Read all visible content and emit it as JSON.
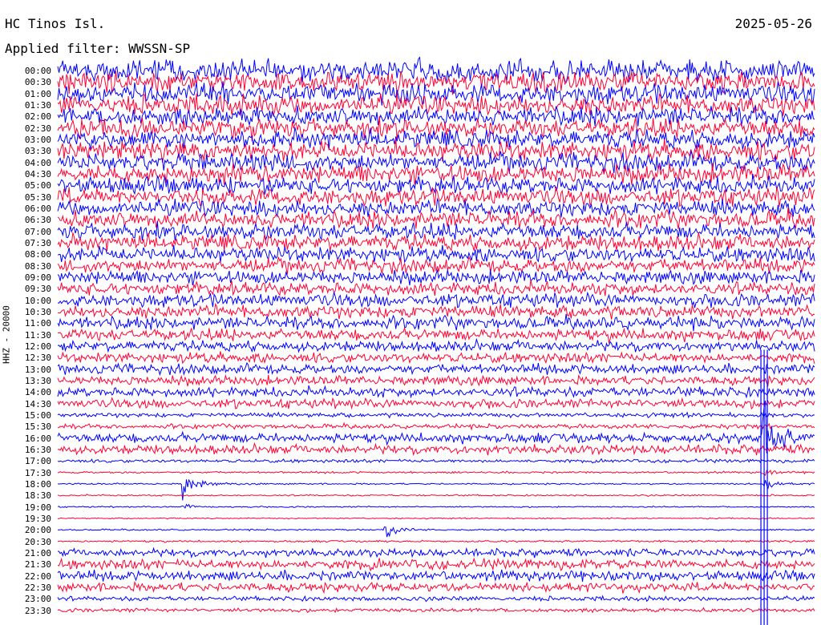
{
  "station": "HC Tinos Isl.",
  "date": "2025-05-26",
  "filter_label": "Applied filter: WWSSN-SP",
  "channel_label": "HHZ - 20000",
  "colors": {
    "odd_rows": "#0000ff",
    "even_rows": "#ff0033",
    "text": "#000000"
  },
  "chart_data": {
    "type": "line",
    "title": "HC Tinos Isl.",
    "xlabel": "",
    "ylabel": "HHZ - 20000",
    "row_labels": [
      "00:00",
      "00:30",
      "01:00",
      "01:30",
      "02:00",
      "02:30",
      "03:00",
      "03:30",
      "04:00",
      "04:30",
      "05:00",
      "05:30",
      "06:00",
      "06:30",
      "07:00",
      "07:30",
      "08:00",
      "08:30",
      "09:00",
      "09:30",
      "10:00",
      "10:30",
      "11:00",
      "11:30",
      "12:00",
      "12:30",
      "13:00",
      "13:30",
      "14:00",
      "14:30",
      "15:00",
      "15:30",
      "16:00",
      "16:30",
      "17:00",
      "17:30",
      "18:00",
      "18:30",
      "19:00",
      "19:30",
      "20:00",
      "20:30",
      "21:00",
      "21:30",
      "22:00",
      "22:30",
      "23:00",
      "23:30"
    ],
    "noise_level": [
      1.6,
      1.6,
      1.5,
      1.5,
      1.4,
      1.4,
      1.4,
      1.4,
      1.35,
      1.35,
      1.3,
      1.3,
      1.25,
      1.25,
      1.2,
      1.2,
      1.1,
      1.05,
      1.0,
      1.0,
      1.0,
      1.0,
      0.95,
      0.9,
      0.8,
      0.75,
      0.75,
      0.7,
      0.75,
      0.7,
      0.35,
      0.35,
      0.75,
      0.7,
      0.25,
      0.15,
      0.12,
      0.12,
      0.1,
      0.1,
      0.12,
      0.15,
      0.6,
      0.75,
      0.75,
      0.7,
      0.35,
      0.3
    ],
    "events": [
      {
        "time": "16:28",
        "amplitude": 6.0
      },
      {
        "time": "18:05",
        "amplitude": 2.6
      },
      {
        "time": "20:13",
        "amplitude": 1.4
      },
      {
        "time": "18:28",
        "amplitude": 1.0
      },
      {
        "time": "19:05",
        "amplitude": 0.7
      },
      {
        "time": "17:58",
        "amplitude": 0.6
      }
    ],
    "grid": false,
    "legend": "none"
  }
}
